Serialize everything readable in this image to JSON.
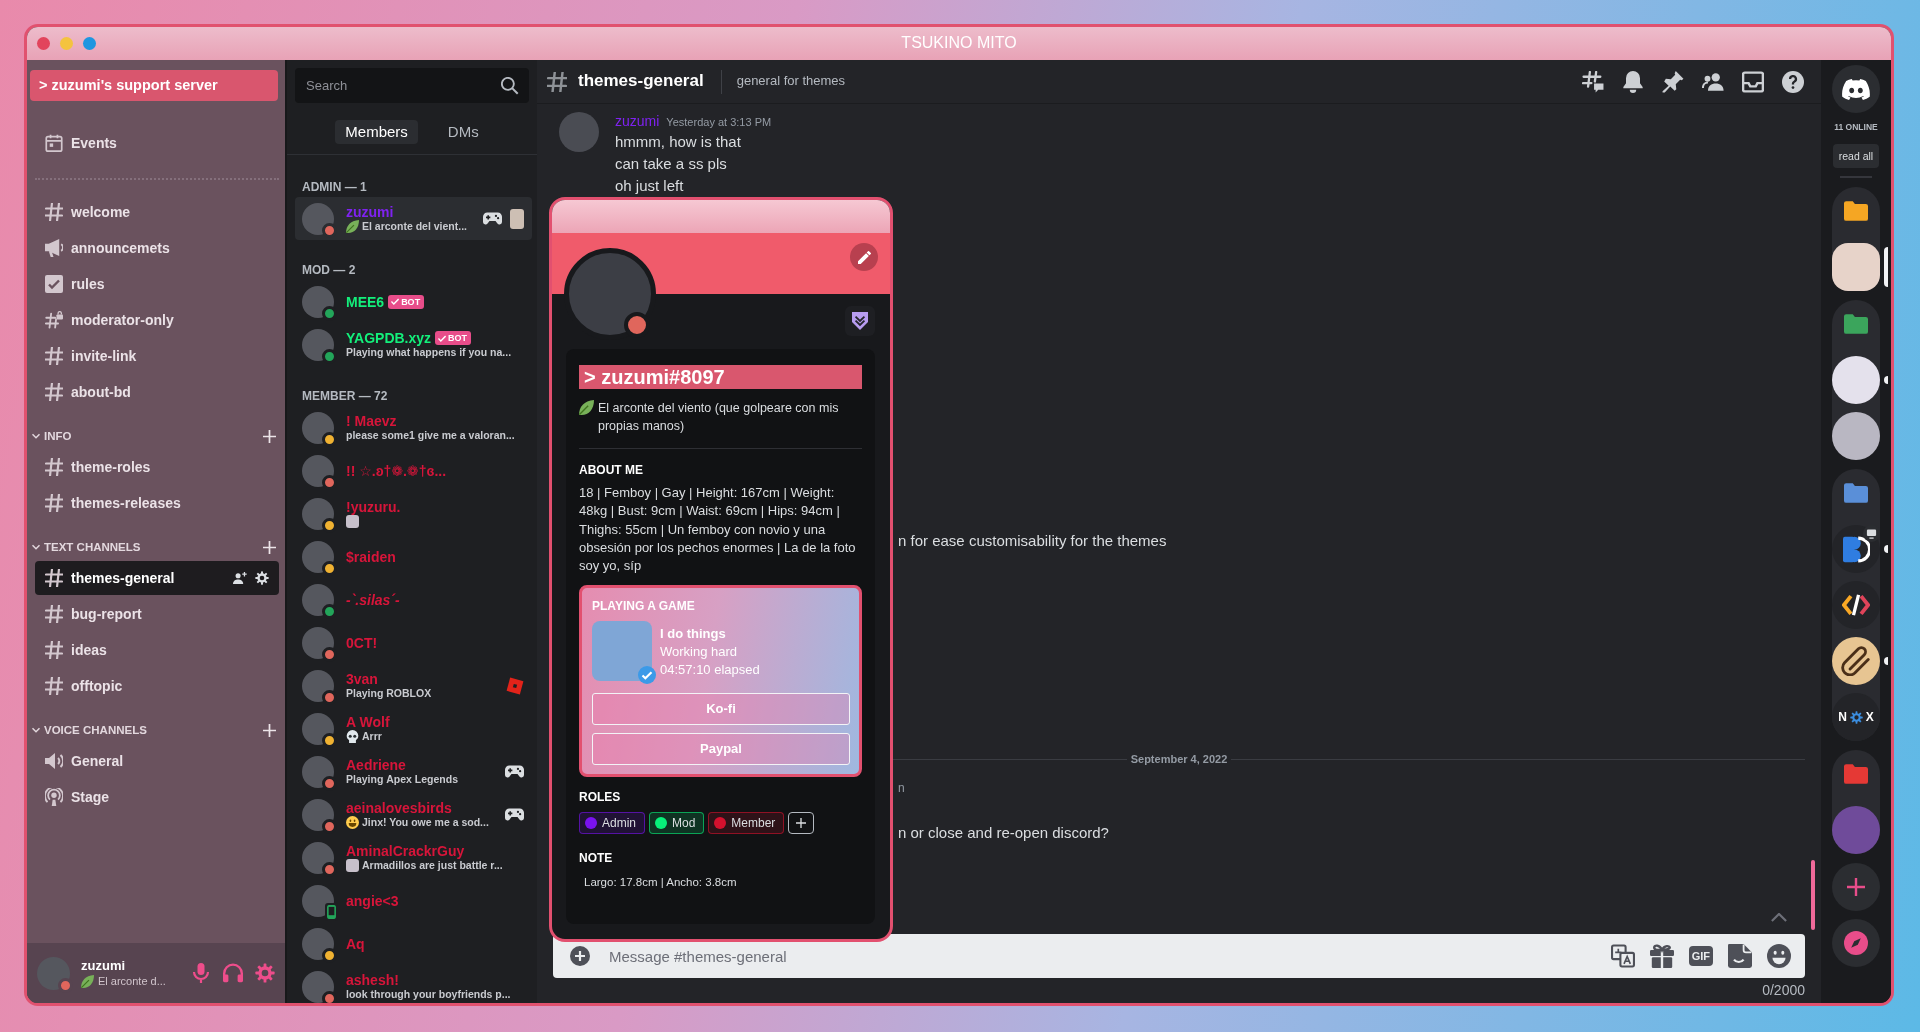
{
  "window": {
    "title": "TSUKINO MITO"
  },
  "sidebar": {
    "server_name": "> zuzumi's support server",
    "events": "Events",
    "channels": [
      {
        "name": "welcome",
        "kind": "text",
        "selected": false
      },
      {
        "name": "announcemets",
        "kind": "announcement",
        "selected": false
      },
      {
        "name": "rules",
        "kind": "rules",
        "selected": false
      },
      {
        "name": "moderator-only",
        "kind": "locked",
        "selected": false
      },
      {
        "name": "invite-link",
        "kind": "text",
        "selected": false
      },
      {
        "name": "about-bd",
        "kind": "text",
        "selected": false
      }
    ],
    "categories": [
      {
        "name": "INFO",
        "expanded": true,
        "channels": [
          {
            "name": "theme-roles",
            "kind": "text",
            "selected": false
          },
          {
            "name": "themes-releases",
            "kind": "text",
            "selected": false
          }
        ]
      },
      {
        "name": "TEXT CHANNELS",
        "expanded": true,
        "channels": [
          {
            "name": "themes-general",
            "kind": "text",
            "selected": true
          },
          {
            "name": "bug-report",
            "kind": "text",
            "selected": false
          },
          {
            "name": "ideas",
            "kind": "text",
            "selected": false
          },
          {
            "name": "offtopic",
            "kind": "text",
            "selected": false
          }
        ]
      },
      {
        "name": "VOICE CHANNELS",
        "expanded": true,
        "channels": [
          {
            "name": "General",
            "kind": "voice",
            "selected": false
          },
          {
            "name": "Stage",
            "kind": "stage",
            "selected": false
          }
        ]
      }
    ],
    "user_panel": {
      "name": "zuzumi",
      "status_dot": {
        "kind": "dot",
        "color": "#e0665c"
      },
      "emoji": {
        "kind": "leaf"
      },
      "custom_status": "El arconte d..."
    }
  },
  "member_list": {
    "search": {
      "placeholder": "Search"
    },
    "tabs": [
      {
        "label": "Members",
        "selected": true
      },
      {
        "label": "DMs",
        "selected": false
      }
    ],
    "groups": [
      {
        "title": "ADMIN — 1",
        "members": [
          {
            "name": "zuzumi",
            "color": "#7f22f0",
            "status_dot": {
              "kind": "dot",
              "color": "#e0665c"
            },
            "selected": true,
            "emoji": {
              "kind": "leaf"
            },
            "activity": "El arconte del vient...",
            "right_icons": [
              {
                "kind": "gamepad"
              },
              {
                "kind": "picture"
              }
            ]
          }
        ]
      },
      {
        "title": "MOD — 2",
        "members": [
          {
            "name": "MEE6",
            "color": "#13ef7b",
            "status_dot": {
              "kind": "dot",
              "color": "#23a55a"
            },
            "selected": false,
            "tag": "BOT"
          },
          {
            "name": "YAGPDB.xyz",
            "color": "#13ef7b",
            "status_dot": {
              "kind": "dot",
              "color": "#23a55a"
            },
            "selected": false,
            "tag": "BOT",
            "activity": "Playing what happens if you na..."
          }
        ]
      },
      {
        "title": "MEMBER — 72",
        "members": [
          {
            "name": "! Maevz",
            "color": "#d7153a",
            "status_dot": {
              "kind": "dot",
              "color": "#f0b232"
            },
            "selected": false,
            "activity": "please some1 give me a valoran..."
          },
          {
            "name": "!! ☆.ʚ†❁.❁†ɞ...",
            "color": "#d7153a",
            "status_dot": {
              "kind": "dot",
              "color": "#e0665c"
            },
            "selected": false
          },
          {
            "name": "!yuzuru.",
            "color": "#d7153a",
            "status_dot": {
              "kind": "dot",
              "color": "#f0b232"
            },
            "selected": false,
            "emoji": {
              "kind": "picture"
            }
          },
          {
            "name": "$raiden",
            "color": "#d7153a",
            "status_dot": {
              "kind": "dot",
              "color": "#f0b232"
            },
            "selected": false
          },
          {
            "name": "-`.silas´-",
            "color": "#d7153a",
            "status_dot": {
              "kind": "dot",
              "color": "#23a55a"
            },
            "selected": false,
            "italic": true
          },
          {
            "name": "0CT!",
            "color": "#d7153a",
            "status_dot": {
              "kind": "dot",
              "color": "#e0665c"
            },
            "selected": false
          },
          {
            "name": "3van",
            "color": "#d7153a",
            "status_dot": {
              "kind": "dot",
              "color": "#e0665c"
            },
            "selected": false,
            "activity": "Playing **ROBLOX**",
            "right_icons": [
              {
                "kind": "roblox"
              }
            ]
          },
          {
            "name": "A Wolf",
            "color": "#d7153a",
            "status_dot": {
              "kind": "dot",
              "color": "#f0b232"
            },
            "selected": false,
            "emoji": {
              "kind": "skull"
            },
            "activity": "Arrr"
          },
          {
            "name": "Aedriene",
            "color": "#d7153a",
            "status_dot": {
              "kind": "dot",
              "color": "#e0665c"
            },
            "selected": false,
            "activity": "Playing **Apex Legends**",
            "right_icons": [
              {
                "kind": "gamepad"
              }
            ]
          },
          {
            "name": "aeinalovesbirds",
            "color": "#d7153a",
            "status_dot": {
              "kind": "dot",
              "color": "#e0665c"
            },
            "selected": false,
            "emoji": {
              "kind": "grin"
            },
            "activity": "Jinx! You owe me a sod...",
            "right_icons": [
              {
                "kind": "gamepad"
              }
            ]
          },
          {
            "name": "AminalCrackrGuy",
            "color": "#d7153a",
            "status_dot": {
              "kind": "dot",
              "color": "#e0665c"
            },
            "selected": false,
            "emoji": {
              "kind": "picture"
            },
            "activity": "Armadillos are just battle r..."
          },
          {
            "name": "angie<3",
            "color": "#d7153a",
            "status_dot": {
              "kind": "phone",
              "color": "#23a55a"
            },
            "selected": false
          },
          {
            "name": "Aq",
            "color": "#d7153a",
            "status_dot": {
              "kind": "dot",
              "color": "#f0b232"
            },
            "selected": false
          },
          {
            "name": "ashesh!",
            "color": "#d7153a",
            "status_dot": {
              "kind": "dot",
              "color": "#e0665c"
            },
            "selected": false,
            "activity": "look through your boyfriends p..."
          }
        ]
      }
    ]
  },
  "channel_header": {
    "name": "themes-general",
    "topic": "general for themes"
  },
  "messages": [
    {
      "kind": "group",
      "author": "zuzumi",
      "color": "#7f22f0",
      "time": "Yesterday at 3:13 PM",
      "lines": [
        "hmmm, how is that",
        "can take a ss pls",
        "oh just left"
      ]
    },
    {
      "kind": "cut-line",
      "text": "n for ease customisability for the themes"
    },
    {
      "kind": "divider",
      "text": "September 4, 2022"
    },
    {
      "kind": "cut-meta",
      "text": "n"
    },
    {
      "kind": "cut-line",
      "text": "n or close and re-open discord?"
    }
  ],
  "composer": {
    "placeholder": "Message #themes-general",
    "gif_label": "GIF",
    "counter": "0/2000"
  },
  "profile_popout": {
    "status_dot": {
      "kind": "dot",
      "color": "#e0665c"
    },
    "username": "> zuzumi#8097",
    "emoji": {
      "kind": "leaf"
    },
    "custom_status": "El arconte del viento (que golpeare con mis propias manos)",
    "about_title": "ABOUT ME",
    "about": "18 | Femboy | Gay | Height: 167cm | Weight: 48kg | Bust: 9cm | Waist: 69cm | Hips: 94cm | Thighs: 55cm | Un femboy con novio y una obsesión por los pechos enormes | La de la foto soy yo, síp",
    "activity": {
      "title": "PLAYING A GAME",
      "name": "I do things",
      "details": "Working hard",
      "elapsed": "04:57:10 elapsed",
      "verified": true,
      "buttons": [
        "Ko-fi",
        "Paypal"
      ]
    },
    "roles_title": "ROLES",
    "roles": [
      {
        "name": "Admin",
        "color": "#7a12f0"
      },
      {
        "name": "Mod",
        "color": "#08f07a"
      },
      {
        "name": "Member",
        "color": "#d4112e"
      }
    ],
    "note_title": "NOTE",
    "note": "Largo: 17.8cm | Ancho: 3.8cm"
  },
  "server_rail": {
    "online": "11 ONLINE",
    "read_all": "read all",
    "items": [
      {
        "kind": "folder",
        "color": "#f5a623",
        "expanded": true,
        "servers": [
          {
            "kind": "picture",
            "color": "#e7d3c9",
            "selected": true,
            "screen_badge": false
          }
        ]
      },
      {
        "kind": "folder",
        "color": "#3ba55c",
        "expanded": true,
        "servers": [
          {
            "kind": "picture",
            "color": "#e4e1ec",
            "selected": false,
            "unread": true,
            "screen_badge": false
          },
          {
            "kind": "picture",
            "color": "#b9b7c2",
            "selected": false,
            "unread": false,
            "screen_badge": false
          }
        ]
      },
      {
        "kind": "folder",
        "color": "#5a8fd8",
        "expanded": true,
        "servers": [
          {
            "kind": "logo",
            "selected": false,
            "unread": true,
            "screen_badge": true
          },
          {
            "kind": "code",
            "selected": false,
            "unread": false,
            "screen_badge": false
          },
          {
            "kind": "paperclip",
            "color": "#e7c592",
            "selected": false,
            "unread": true,
            "screen_badge": false
          },
          {
            "kind": "lettered",
            "letters": [
              "N",
              "X"
            ],
            "selected": false,
            "unread": false,
            "screen_badge": false
          }
        ]
      },
      {
        "kind": "folder",
        "color": "#e53935",
        "expanded": true,
        "servers": [
          {
            "kind": "picture",
            "color": "#6f4b9a",
            "selected": false,
            "unread": false,
            "screen_badge": false
          }
        ]
      }
    ]
  }
}
